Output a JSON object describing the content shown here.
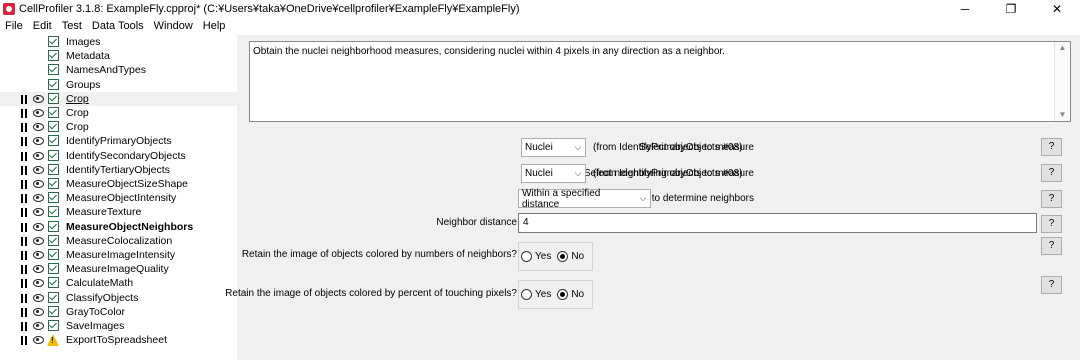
{
  "window": {
    "title": "CellProfiler 3.1.8: ExampleFly.cpproj* (C:¥Users¥taka¥OneDrive¥cellprofiler¥ExampleFly¥ExampleFly)",
    "minimize": "─",
    "maximize": "❐",
    "close": "✕"
  },
  "menu": [
    "File",
    "Edit",
    "Test",
    "Data Tools",
    "Window",
    "Help"
  ],
  "pipeline": {
    "modules": [
      {
        "name": "Images",
        "controls": false,
        "status": "check",
        "style": ""
      },
      {
        "name": "Metadata",
        "controls": false,
        "status": "check",
        "style": ""
      },
      {
        "name": "NamesAndTypes",
        "controls": false,
        "status": "check",
        "style": ""
      },
      {
        "name": "Groups",
        "controls": false,
        "status": "check",
        "style": ""
      },
      {
        "name": "Crop",
        "controls": true,
        "status": "check",
        "style": "underline"
      },
      {
        "name": "Crop",
        "controls": true,
        "status": "check",
        "style": ""
      },
      {
        "name": "Crop",
        "controls": true,
        "status": "check",
        "style": ""
      },
      {
        "name": "IdentifyPrimaryObjects",
        "controls": true,
        "status": "check",
        "style": ""
      },
      {
        "name": "IdentifySecondaryObjects",
        "controls": true,
        "status": "check",
        "style": ""
      },
      {
        "name": "IdentifyTertiaryObjects",
        "controls": true,
        "status": "check",
        "style": ""
      },
      {
        "name": "MeasureObjectSizeShape",
        "controls": true,
        "status": "check",
        "style": ""
      },
      {
        "name": "MeasureObjectIntensity",
        "controls": true,
        "status": "check",
        "style": ""
      },
      {
        "name": "MeasureTexture",
        "controls": true,
        "status": "check",
        "style": ""
      },
      {
        "name": "MeasureObjectNeighbors",
        "controls": true,
        "status": "check",
        "style": "bold"
      },
      {
        "name": "MeasureColocalization",
        "controls": true,
        "status": "check",
        "style": ""
      },
      {
        "name": "MeasureImageIntensity",
        "controls": true,
        "status": "check",
        "style": ""
      },
      {
        "name": "MeasureImageQuality",
        "controls": true,
        "status": "check",
        "style": ""
      },
      {
        "name": "CalculateMath",
        "controls": true,
        "status": "check",
        "style": ""
      },
      {
        "name": "ClassifyObjects",
        "controls": true,
        "status": "check",
        "style": ""
      },
      {
        "name": "GrayToColor",
        "controls": true,
        "status": "check",
        "style": ""
      },
      {
        "name": "SaveImages",
        "controls": true,
        "status": "check",
        "style": ""
      },
      {
        "name": "ExportToSpreadsheet",
        "controls": true,
        "status": "warning",
        "style": ""
      }
    ]
  },
  "settings": {
    "notes": "Obtain the nuclei neighborhood measures, considering nuclei within 4 pixels in any direction as a neighbor.",
    "objects_label": "Select objects to measure",
    "objects_value": "Nuclei",
    "objects_from": "(from IdentifyPrimaryObjects #08)",
    "neighbors_label": "Select neighboring objects to measure",
    "neighbors_value": "Nuclei",
    "neighbors_from": "(from IdentifyPrimaryObjects #08)",
    "method_label": "Method to determine neighbors",
    "method_value": "Within a specified distance",
    "distance_label": "Neighbor distance",
    "distance_value": "4",
    "retain_neighbors_label": "Retain the image of objects colored by numbers of neighbors?",
    "retain_touching_label": "Retain the image of objects colored by percent of touching pixels?",
    "yes": "Yes",
    "no": "No",
    "retain_neighbors_value": "No",
    "retain_touching_value": "No",
    "help": "?"
  }
}
